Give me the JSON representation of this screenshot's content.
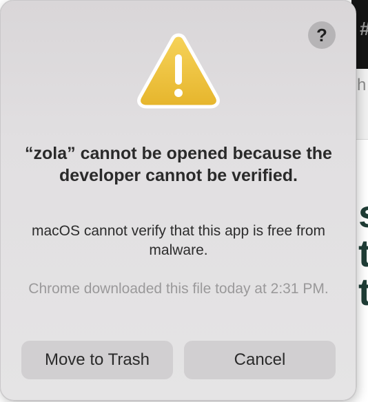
{
  "background_app": {
    "topbar_glyph": "#",
    "tab_glyph": "h",
    "letters": [
      "s",
      "t",
      "t"
    ]
  },
  "dialog": {
    "help_label": "?",
    "icon": "warning-triangle-icon",
    "title": "“zola” cannot be opened because the developer cannot be verified.",
    "message": "macOS cannot verify that this app is free from malware.",
    "info": "Chrome downloaded this file today at 2:31 PM.",
    "buttons": {
      "move_to_trash": "Move to Trash",
      "cancel": "Cancel"
    }
  },
  "colors": {
    "warning_fill": "#f0c640",
    "dialog_bg": "#e1dfe1",
    "button_bg": "#d1cfd1"
  }
}
